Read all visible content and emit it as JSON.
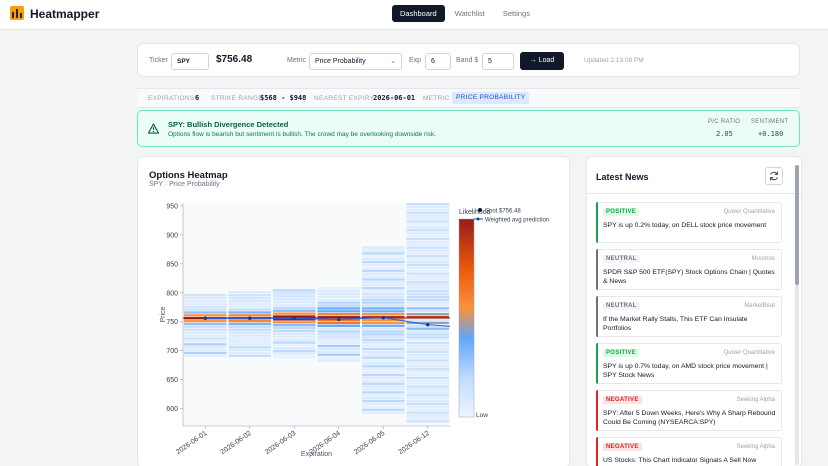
{
  "app": {
    "title": "Heatmapper",
    "nav": [
      {
        "label": "Dashboard",
        "active": true
      },
      {
        "label": "Watchlist",
        "active": false
      },
      {
        "label": "Settings",
        "active": false
      }
    ]
  },
  "controls": {
    "ticker_label": "Ticker",
    "ticker_value": "SPY",
    "price": "$756.48",
    "metric_label": "Metric",
    "metric_value": "Price Probability",
    "exp_label": "Exp",
    "exp_value": "6",
    "band_label": "Band $",
    "band_value": "5",
    "load_label": "Load",
    "updated": "Updated 2:13:09 PM"
  },
  "stats": {
    "expirations_label": "EXPIRATIONS",
    "expirations_value": "6",
    "strike_range_label": "STRIKE RANGE",
    "strike_range_value": "$568 - $948",
    "nearest_expiry_label": "NEAREST EXPIRY",
    "nearest_expiry_value": "2026-06-01",
    "metric_label": "METRIC",
    "metric_value": "PRICE PROBABILITY"
  },
  "alert": {
    "title": "SPY: Bullish Divergence Detected",
    "text": "Options flow is bearish but sentiment is bullish. The crowd may be overlooking downside risk.",
    "pc_label": "P/C RATIO",
    "pc_value": "2.05",
    "sentiment_label": "SENTIMENT",
    "sentiment_value": "+0.180"
  },
  "heatmap": {
    "title": "Options Heatmap",
    "subtitle": "SPY · Price Probability"
  },
  "chart_data": {
    "type": "heatmap",
    "title": "Options Heatmap",
    "subtitle": "SPY · Price Probability",
    "xlabel": "Expiration",
    "ylabel": "Price",
    "categories": [
      "2026-06-01",
      "2026-06-02",
      "2026-06-03",
      "2026-06-04",
      "2026-06-05",
      "2026-06-12"
    ],
    "ylim": [
      570,
      955
    ],
    "yticks": [
      600,
      650,
      700,
      750,
      800,
      850,
      900,
      950
    ],
    "spot": 756.48,
    "weighted_avg": [
      756,
      756,
      756,
      754,
      757,
      745
    ],
    "colorbar": {
      "title": "Likelihood",
      "top_label": "",
      "bottom_label": "Low"
    },
    "legend": [
      {
        "label": "Spot $756.48",
        "color": "#111827"
      },
      {
        "label": "Weighted avg prediction",
        "color": "#2563eb"
      }
    ],
    "series": [
      {
        "name": "2026-06-01",
        "band_lo": 688,
        "band_hi": 798,
        "intensity": [
          [
            752,
            0.55
          ],
          [
            756,
            1.0
          ],
          [
            760,
            0.55
          ],
          [
            745,
            0.3
          ],
          [
            765,
            0.3
          ],
          [
            738,
            0.15
          ],
          [
            770,
            0.15
          ]
        ]
      },
      {
        "name": "2026-06-02",
        "band_lo": 688,
        "band_hi": 800,
        "intensity": [
          [
            752,
            0.6
          ],
          [
            756,
            1.0
          ],
          [
            760,
            0.6
          ],
          [
            745,
            0.35
          ],
          [
            765,
            0.35
          ],
          [
            738,
            0.18
          ],
          [
            772,
            0.18
          ]
        ]
      },
      {
        "name": "2026-06-03",
        "band_lo": 686,
        "band_hi": 802,
        "intensity": [
          [
            750,
            0.55
          ],
          [
            756,
            1.0
          ],
          [
            762,
            0.55
          ],
          [
            744,
            0.32
          ],
          [
            768,
            0.32
          ],
          [
            736,
            0.2
          ],
          [
            775,
            0.2
          ]
        ]
      },
      {
        "name": "2026-06-04",
        "band_lo": 680,
        "band_hi": 808,
        "intensity": [
          [
            750,
            0.65
          ],
          [
            756,
            0.95
          ],
          [
            762,
            0.6
          ],
          [
            742,
            0.4
          ],
          [
            770,
            0.38
          ],
          [
            732,
            0.22
          ],
          [
            780,
            0.22
          ]
        ]
      },
      {
        "name": "2026-06-05",
        "band_lo": 590,
        "band_hi": 880,
        "intensity": [
          [
            750,
            0.55
          ],
          [
            756,
            0.9
          ],
          [
            762,
            0.55
          ],
          [
            742,
            0.38
          ],
          [
            770,
            0.36
          ],
          [
            730,
            0.22
          ],
          [
            785,
            0.22
          ]
        ]
      },
      {
        "name": "2026-06-12",
        "band_lo": 575,
        "band_hi": 955,
        "intensity": [
          [
            748,
            0.45
          ],
          [
            756,
            0.85
          ],
          [
            764,
            0.45
          ],
          [
            738,
            0.32
          ],
          [
            772,
            0.3
          ],
          [
            725,
            0.2
          ],
          [
            790,
            0.2
          ]
        ]
      }
    ]
  },
  "news": {
    "title": "Latest News",
    "items": [
      {
        "sentiment": "POSITIVE",
        "source": "Quiver Quantitative",
        "headline": "SPY is up 0.2% today, on DELL stock price movement"
      },
      {
        "sentiment": "NEUTRAL",
        "source": "Moomoo",
        "headline": "SPDR S&P 500 ETF(SPY) Stock Options Chain | Quotes & News"
      },
      {
        "sentiment": "NEUTRAL",
        "source": "MarketBeat",
        "headline": "If the Market Rally Stalls, This ETF Can Insulate Portfolios"
      },
      {
        "sentiment": "POSITIVE",
        "source": "Quiver Quantitative",
        "headline": "SPY is up 0.7% today, on AMD stock price movement | SPY Stock News"
      },
      {
        "sentiment": "NEGATIVE",
        "source": "Seeking Alpha",
        "headline": "SPY: After 5 Down Weeks, Here's Why A Sharp Rebound Could Be Coming (NYSEARCA:SPY)"
      },
      {
        "sentiment": "NEGATIVE",
        "source": "Seeking Alpha",
        "headline": "US Stocks: This Chart Indicator Signals A Sell Now (NYSEARCA:SPY)"
      }
    ]
  },
  "colors": {
    "positive": "#16a34a",
    "neutral": "#6b7280",
    "negative": "#dc2626",
    "accent": "#111827"
  }
}
